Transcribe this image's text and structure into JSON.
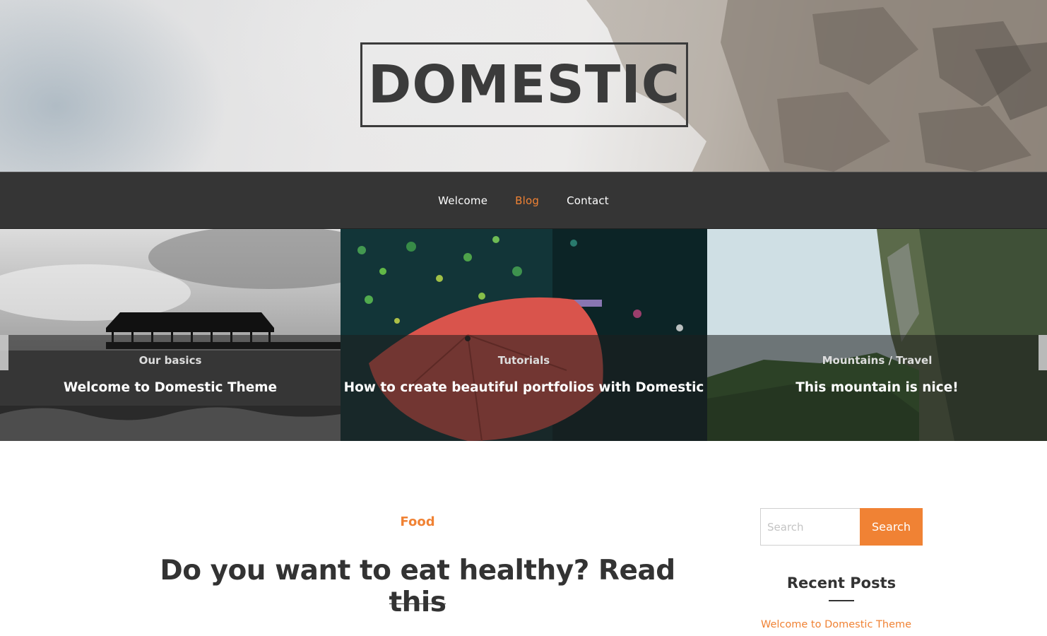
{
  "header": {
    "logo": "DOMESTIC"
  },
  "nav": {
    "items": [
      {
        "label": "Welcome",
        "active": false
      },
      {
        "label": "Blog",
        "active": true
      },
      {
        "label": "Contact",
        "active": false
      }
    ]
  },
  "slider": {
    "slides": [
      {
        "category": "Our basics",
        "title": "Welcome to Domestic Theme"
      },
      {
        "category": "Tutorials",
        "title": "How to create beautiful portfolios with Domestic"
      },
      {
        "category": "Mountains / Travel",
        "title": "This mountain is nice!"
      }
    ]
  },
  "post": {
    "category": "Food",
    "title": "Do you want to eat healthy? Read this"
  },
  "sidebar": {
    "search": {
      "placeholder": "Search",
      "button": "Search"
    },
    "recent_posts": {
      "title": "Recent Posts",
      "items": [
        "Welcome to Domestic Theme"
      ]
    }
  },
  "colors": {
    "accent": "#f08234",
    "nav_bg": "#353535",
    "text": "#333333"
  }
}
